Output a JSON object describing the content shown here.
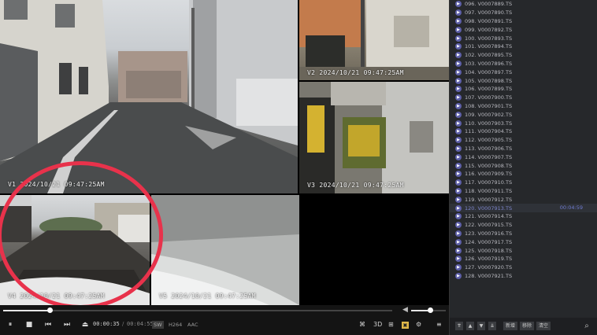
{
  "tiles": {
    "t1": {
      "timestamp": "V1  2024/10/21  09:47:25AM"
    },
    "t2": {
      "timestamp": "V2  2024/10/21  09:47:25AM"
    },
    "t3": {
      "timestamp": "V3  2024/10/21  09:47:25AM"
    },
    "t4": {
      "timestamp": "V4  2024/10/21  09:47:25AM"
    },
    "t5": {
      "timestamp": "V5  2024/10/21  09:47:25AM"
    }
  },
  "controls": {
    "current_time": "00:00:35",
    "separator": "/",
    "total_time": "00:04:55",
    "progress_fraction": 0.12,
    "volume_fraction": 0.55,
    "tags": [
      "SW",
      "H264",
      "AAC"
    ],
    "buttons": {
      "play_pause": "⏸",
      "stop": "■",
      "prev": "⏮",
      "next": "⏭",
      "eject": "⏏",
      "three_d": "3D",
      "layout": "⊞",
      "settings": "⚙",
      "menu": "≡",
      "snapshot": "⌘"
    }
  },
  "playlist": {
    "items": [
      {
        "label": "096. V0007889.TS"
      },
      {
        "label": "097. V0007890.TS"
      },
      {
        "label": "098. V0007891.TS"
      },
      {
        "label": "099. V0007892.TS"
      },
      {
        "label": "100. V0007893.TS"
      },
      {
        "label": "101. V0007894.TS"
      },
      {
        "label": "102. V0007895.TS"
      },
      {
        "label": "103. V0007896.TS"
      },
      {
        "label": "104. V0007897.TS"
      },
      {
        "label": "105. V0007898.TS"
      },
      {
        "label": "106. V0007899.TS"
      },
      {
        "label": "107. V0007900.TS"
      },
      {
        "label": "108. V0007901.TS"
      },
      {
        "label": "109. V0007902.TS"
      },
      {
        "label": "110. V0007903.TS"
      },
      {
        "label": "111. V0007904.TS"
      },
      {
        "label": "112. V0007905.TS"
      },
      {
        "label": "113. V0007906.TS"
      },
      {
        "label": "114. V0007907.TS"
      },
      {
        "label": "115. V0007908.TS"
      },
      {
        "label": "116. V0007909.TS"
      },
      {
        "label": "117. V0007910.TS"
      },
      {
        "label": "118. V0007911.TS"
      },
      {
        "label": "119. V0007912.TS"
      },
      {
        "label": "120. V0007913.TS",
        "duration": "00:04:59",
        "active": true
      },
      {
        "label": "121. V0007914.TS"
      },
      {
        "label": "122. V0007915.TS"
      },
      {
        "label": "123. V0007916.TS"
      },
      {
        "label": "124. V0007917.TS"
      },
      {
        "label": "125. V0007918.TS"
      },
      {
        "label": "126. V0007919.TS"
      },
      {
        "label": "127. V0007920.TS"
      },
      {
        "label": "128. V0007921.TS"
      }
    ],
    "toolbar": {
      "move_top": "⇈",
      "move_up": "▲",
      "move_down": "▼",
      "move_bottom": "⇊",
      "new": "新增",
      "remove": "移除",
      "clear": "清空",
      "search": "⌕"
    }
  }
}
